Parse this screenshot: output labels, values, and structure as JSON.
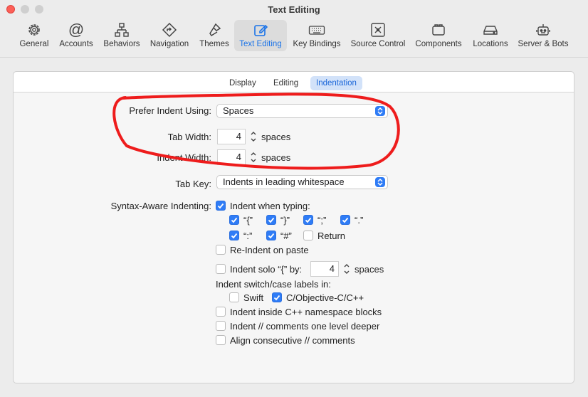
{
  "window": {
    "title": "Text Editing"
  },
  "toolbar": {
    "items": [
      {
        "label": "General",
        "icon": "gear-icon"
      },
      {
        "label": "Accounts",
        "icon": "at-icon"
      },
      {
        "label": "Behaviors",
        "icon": "behaviors-icon"
      },
      {
        "label": "Navigation",
        "icon": "navigation-icon"
      },
      {
        "label": "Themes",
        "icon": "brush-icon"
      },
      {
        "label": "Text Editing",
        "icon": "edit-icon",
        "active": true
      },
      {
        "label": "Key Bindings",
        "icon": "keyboard-icon"
      },
      {
        "label": "Source Control",
        "icon": "source-control-icon"
      },
      {
        "label": "Components",
        "icon": "components-icon"
      },
      {
        "label": "Locations",
        "icon": "drive-icon"
      },
      {
        "label": "Server & Bots",
        "icon": "bot-icon"
      }
    ]
  },
  "tabs": [
    {
      "label": "Display"
    },
    {
      "label": "Editing"
    },
    {
      "label": "Indentation",
      "active": true
    }
  ],
  "settings": {
    "prefer_indent_label": "Prefer Indent Using:",
    "prefer_indent_value": "Spaces",
    "tab_width_label": "Tab Width:",
    "tab_width_value": "4",
    "indent_width_label": "Indent Width:",
    "indent_width_value": "4",
    "spaces_unit": "spaces",
    "tab_key_label": "Tab Key:",
    "tab_key_value": "Indents in leading whitespace",
    "syntax_label": "Syntax-Aware Indenting:",
    "indent_when_typing": "Indent when typing:",
    "chars": [
      {
        "label": "“{”",
        "checked": true
      },
      {
        "label": "“}”",
        "checked": true
      },
      {
        "label": "“;”",
        "checked": true
      },
      {
        "label": "“.”",
        "checked": true
      },
      {
        "label": "“:”",
        "checked": true
      },
      {
        "label": "“#”",
        "checked": true
      },
      {
        "label": "Return",
        "checked": false
      }
    ],
    "reindent_paste": "Re-Indent on paste",
    "indent_solo_label": "Indent solo “{” by:",
    "indent_solo_value": "4",
    "switch_case_label": "Indent switch/case labels in:",
    "swift_label": "Swift",
    "c_label": "C/Objective-C/C++",
    "cpp_namespace": "Indent inside C++ namespace blocks",
    "comments_deeper": "Indent // comments one level deeper",
    "align_comments": "Align consecutive // comments"
  },
  "colors": {
    "accent": "#2f7cf6",
    "annotation": "#ee1c1c"
  }
}
